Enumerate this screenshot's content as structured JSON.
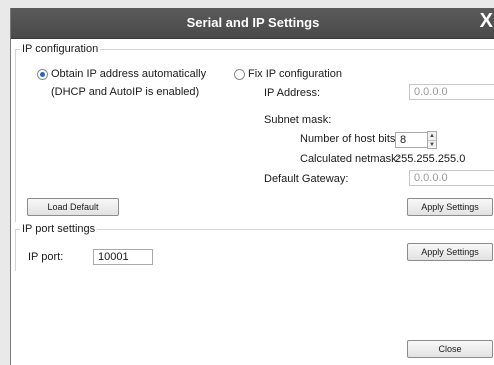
{
  "dialog": {
    "title": "Serial and IP Settings",
    "close_glyph": "X"
  },
  "ip_config": {
    "legend": "IP configuration",
    "auto_label": "Obtain IP address automatically",
    "auto_checked": true,
    "auto_note": "(DHCP and AutoIP is enabled)",
    "fix_label": "Fix IP configuration",
    "fix_checked": false,
    "ip_address_label": "IP Address:",
    "ip_address_value": "0.0.0.0",
    "subnet_label": "Subnet mask:",
    "host_bits_label": "Number of host bits:",
    "host_bits_value": "8",
    "netmask_label": "Calculated netmask:",
    "netmask_value": "255.255.255.0",
    "gateway_label": "Default Gateway:",
    "gateway_value": "0.0.0.0",
    "load_default": "Load Default",
    "apply": "Apply Settings"
  },
  "port_settings": {
    "legend": "IP port settings",
    "port_label": "IP port:",
    "port_value": "10001",
    "apply": "Apply Settings"
  },
  "footer": {
    "close": "Close"
  },
  "icons": {
    "spin_up": "spin-up-icon",
    "spin_down": "spin-down-icon"
  }
}
